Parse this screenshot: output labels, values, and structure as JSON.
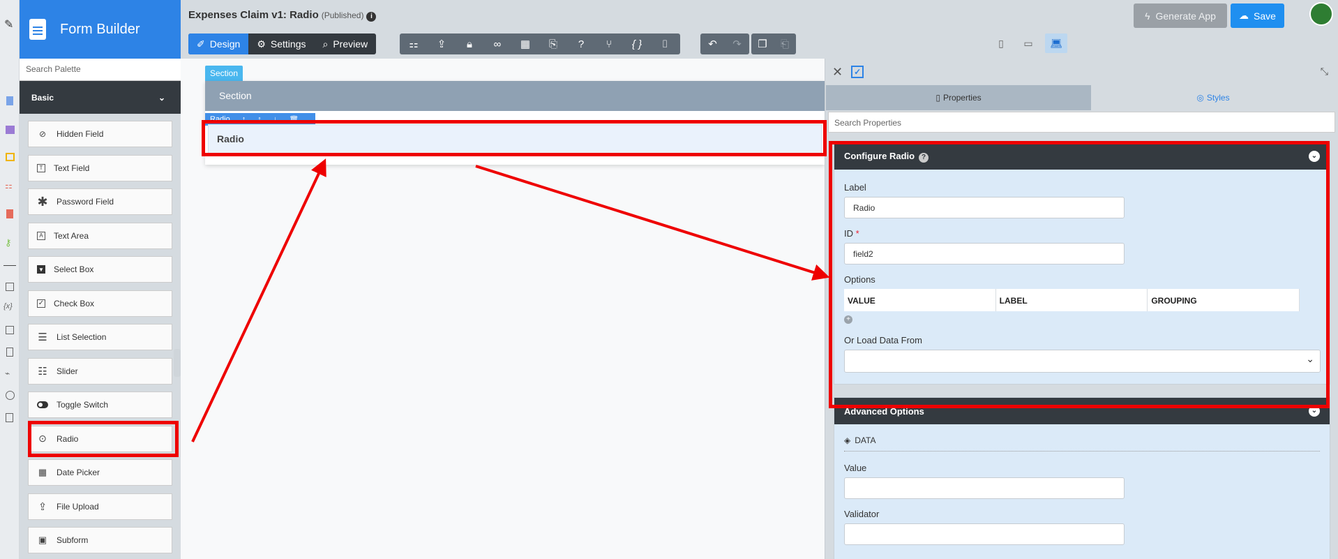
{
  "palette": {
    "title": "Form Builder",
    "search_placeholder": "Search Palette",
    "category": "Basic",
    "items": [
      {
        "label": "Hidden Field",
        "icon": "eye-slash-icon"
      },
      {
        "label": "Text Field",
        "icon": "text-field-icon"
      },
      {
        "label": "Password Field",
        "icon": "asterisk-icon"
      },
      {
        "label": "Text Area",
        "icon": "text-area-icon"
      },
      {
        "label": "Select Box",
        "icon": "select-box-icon"
      },
      {
        "label": "Check Box",
        "icon": "check-box-icon"
      },
      {
        "label": "List Selection",
        "icon": "list-icon"
      },
      {
        "label": "Slider",
        "icon": "sliders-icon"
      },
      {
        "label": "Toggle Switch",
        "icon": "toggle-icon"
      },
      {
        "label": "Radio",
        "icon": "radio-icon"
      },
      {
        "label": "Date Picker",
        "icon": "calendar-icon"
      },
      {
        "label": "File Upload",
        "icon": "upload-icon"
      },
      {
        "label": "Subform",
        "icon": "subform-icon"
      }
    ]
  },
  "header": {
    "title": "Expenses Claim v1: Radio",
    "status": "(Published)",
    "tabs": [
      {
        "label": "Design",
        "icon": "pencil-ruler-icon"
      },
      {
        "label": "Settings",
        "icon": "gear-icon"
      },
      {
        "label": "Preview",
        "icon": "preview-icon"
      }
    ],
    "generate_label": "Generate App",
    "save_label": "Save"
  },
  "canvas": {
    "section_tag": "Section",
    "section_title": "Section",
    "element_tag": "Radio",
    "field_label": "Radio"
  },
  "properties": {
    "tab_properties": "Properties",
    "tab_styles": "Styles",
    "search_placeholder": "Search Properties",
    "configure_title": "Configure Radio",
    "label_caption": "Label",
    "label_value": "Radio",
    "id_caption": "ID",
    "id_required": "*",
    "id_value": "field2",
    "options_caption": "Options",
    "options_columns": [
      "VALUE",
      "LABEL",
      "GROUPING"
    ],
    "load_caption": "Or Load Data From",
    "load_value": "",
    "advanced_title": "Advanced Options",
    "data_section": "DATA",
    "value_caption": "Value",
    "value_value": "",
    "validator_caption": "Validator"
  },
  "colors": {
    "brand_blue": "#2d83e6",
    "dark": "#343a40",
    "annotation_red": "#ee0000"
  }
}
